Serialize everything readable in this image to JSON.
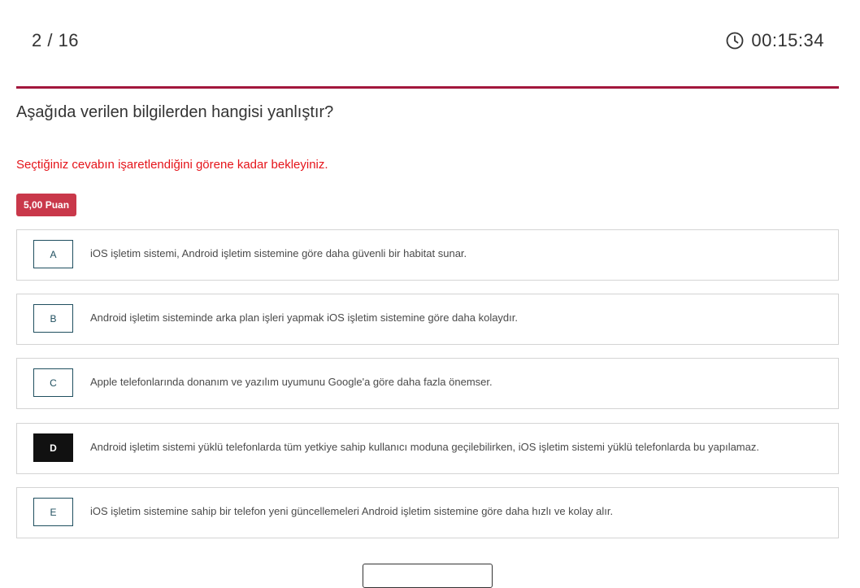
{
  "header": {
    "counter": "2 / 16",
    "timer": "00:15:34",
    "timer_icon": "clock-icon"
  },
  "question": {
    "text": "Aşağıda verilen bilgilerden hangisi yanlıştır?",
    "warning": "Seçtiğiniz cevabın işaretlendiğini görene kadar bekleyiniz.",
    "points": "5,00 Puan"
  },
  "options": [
    {
      "letter": "A",
      "text": "iOS işletim sistemi, Android işletim sistemine göre daha güvenli bir habitat sunar.",
      "selected": false
    },
    {
      "letter": "B",
      "text": "Android işletim sisteminde arka plan işleri yapmak iOS işletim sistemine göre daha kolaydır.",
      "selected": false
    },
    {
      "letter": "C",
      "text": "Apple telefonlarında donanım ve yazılım uyumunu Google'a göre daha fazla önemser.",
      "selected": false
    },
    {
      "letter": "D",
      "text": "Android işletim sistemi yüklü telefonlarda tüm yetkiye sahip kullanıcı moduna geçilebilirken, iOS işletim sistemi yüklü telefonlarda bu yapılamaz.",
      "selected": true
    },
    {
      "letter": "E",
      "text": "iOS işletim sistemine sahip bir telefon yeni güncellemeleri Android işletim sistemine göre daha hızlı ve kolay alır.",
      "selected": false
    }
  ],
  "colors": {
    "accent": "#a3173d",
    "warning": "#e5141a",
    "badge": "#c9384a",
    "selected": "#111111"
  }
}
